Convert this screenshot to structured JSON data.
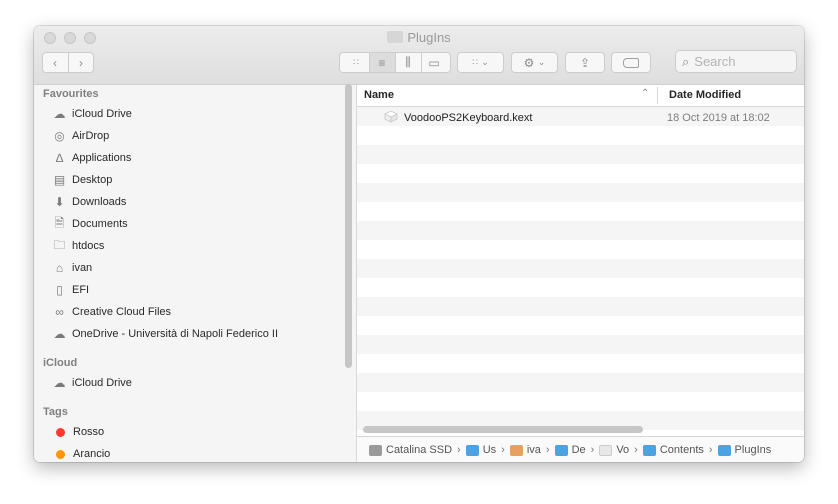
{
  "window": {
    "title": "PlugIns"
  },
  "toolbar": {
    "search_placeholder": "Search"
  },
  "sidebar": {
    "sections": [
      {
        "label": "Favourites"
      },
      {
        "label": "iCloud"
      },
      {
        "label": "Tags"
      }
    ],
    "favourites": [
      {
        "label": "iCloud Drive"
      },
      {
        "label": "AirDrop"
      },
      {
        "label": "Applications"
      },
      {
        "label": "Desktop"
      },
      {
        "label": "Downloads"
      },
      {
        "label": "Documents"
      },
      {
        "label": "htdocs"
      },
      {
        "label": "ivan"
      },
      {
        "label": "EFI"
      },
      {
        "label": "Creative Cloud Files"
      },
      {
        "label": "OneDrive - Università di Napoli Federico II"
      }
    ],
    "icloud": [
      {
        "label": "iCloud Drive"
      }
    ],
    "tags": [
      {
        "label": "Rosso",
        "color": "#ff3b30"
      },
      {
        "label": "Arancio",
        "color": "#ff9500"
      }
    ]
  },
  "list": {
    "columns": {
      "name": "Name",
      "date": "Date Modified"
    },
    "files": [
      {
        "name": "VoodooPS2Keyboard.kext",
        "date": "18 Oct 2019 at 18:02"
      }
    ]
  },
  "pathbar": {
    "items": [
      {
        "label": "Catalina SSD"
      },
      {
        "label": "Us"
      },
      {
        "label": "iva"
      },
      {
        "label": "De"
      },
      {
        "label": "Vo"
      },
      {
        "label": "Contents"
      },
      {
        "label": "PlugIns"
      }
    ]
  },
  "colors": {
    "folder_blue": "#4ba3e3",
    "sidebar_bg": "#f5f5f5"
  }
}
